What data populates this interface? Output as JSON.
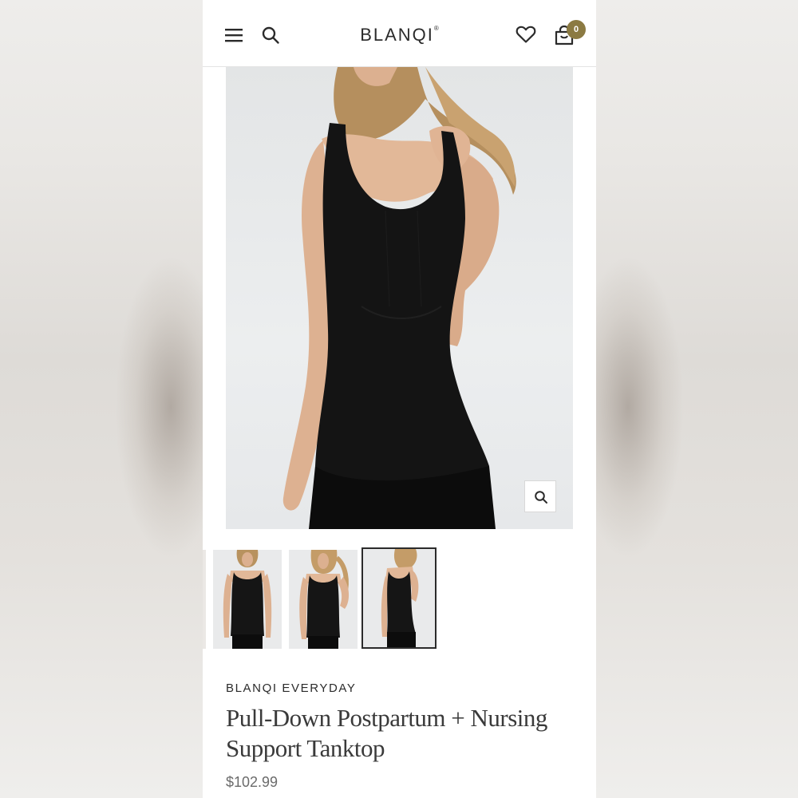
{
  "header": {
    "logo": "BLANQI",
    "logo_mark": "®",
    "cart_count": "0",
    "icons": [
      "menu-icon",
      "search-icon",
      "heart-icon",
      "cart-icon"
    ]
  },
  "gallery": {
    "zoom_icon": "zoom-icon",
    "thumbnail_count": 3,
    "active_thumbnail": 3
  },
  "product": {
    "brand": "BLANQI EVERYDAY",
    "title": "Pull-Down Postpartum + Nursing Support Tanktop",
    "price": "$102.99"
  },
  "colors": {
    "badge": "#8b7a42",
    "text": "#2b2b2b",
    "price": "#6b6b6b"
  }
}
